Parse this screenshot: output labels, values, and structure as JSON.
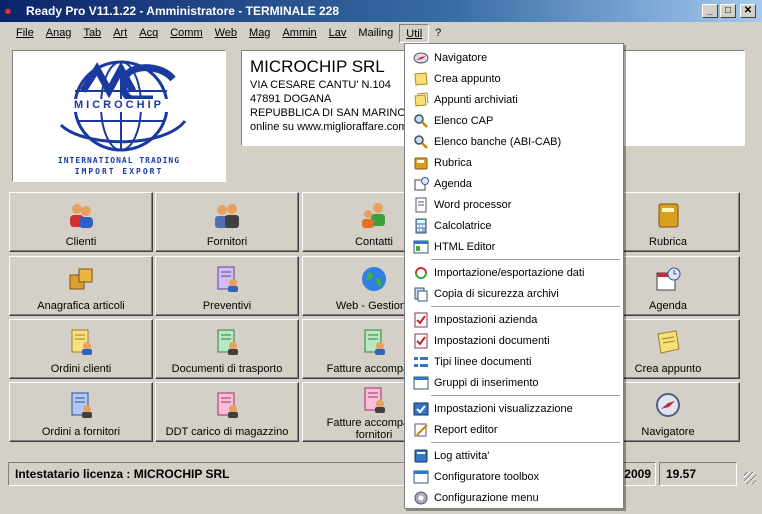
{
  "window": {
    "title": "Ready Pro V11.1.22 - Amministratore - TERMINALE 228",
    "min_glyph": "_",
    "max_glyph": "□",
    "close_glyph": "✕"
  },
  "menubar": {
    "items": [
      "File",
      "Anag",
      "Tab",
      "Art",
      "Acq",
      "Comm",
      "Web",
      "Mag",
      "Ammin",
      "Lav",
      "Mailing",
      "Util",
      "?"
    ],
    "active": "Util"
  },
  "logo": {
    "brand": "MICROCHIP",
    "tagline1": "INTERNATIONAL TRADING",
    "tagline2": "IMPORT  EXPORT"
  },
  "company": {
    "name": "MICROCHIP SRL",
    "address": "VIA CESARE CANTU' N.104",
    "city": "47891 DOGANA",
    "country": "REPUBBLICA DI SAN MARINO",
    "web": "online su www.miglioraffare.com"
  },
  "buttons": [
    {
      "label": "Clienti",
      "icon": "people-icon"
    },
    {
      "label": "Fornitori",
      "icon": "business-people-icon"
    },
    {
      "label": "Contatti",
      "icon": "contacts-icon"
    },
    {
      "label": "Rubrica",
      "icon": "address-book-icon"
    },
    {
      "label": "Anagrafica articoli",
      "icon": "boxes-icon"
    },
    {
      "label": "Preventivi",
      "icon": "quote-document-icon"
    },
    {
      "label": "Web - Gestione",
      "icon": "globe-icon"
    },
    {
      "label": "Agenda",
      "icon": "calendar-clock-icon"
    },
    {
      "label": "Ordini clienti",
      "icon": "customer-orders-icon"
    },
    {
      "label": "Documenti di trasporto",
      "icon": "transport-document-icon"
    },
    {
      "label": "Fatture accompagn",
      "icon": "invoice-icon"
    },
    {
      "label": "Crea appunto",
      "icon": "note-icon"
    },
    {
      "label": "Ordini a fornitori",
      "icon": "supplier-orders-icon"
    },
    {
      "label": "DDT carico di magazzino",
      "icon": "warehouse-document-icon"
    },
    {
      "label": "Fatture accompagn",
      "label2": "fornitori",
      "icon": "supplier-invoice-icon"
    },
    {
      "label": "Navigatore",
      "icon": "navigator-icon"
    }
  ],
  "status": {
    "license": "Intestatario licenza : MICROCHIP SRL",
    "date_fragment": "2009",
    "time": "19.57"
  },
  "util_menu": {
    "items": [
      {
        "label": "Navigatore",
        "icon": "compass-icon"
      },
      {
        "label": "Crea appunto",
        "icon": "note-icon"
      },
      {
        "label": "Appunti archiviati",
        "icon": "notes-archive-icon"
      },
      {
        "label": "Elenco CAP",
        "icon": "magnifier-icon"
      },
      {
        "label": "Elenco banche (ABI-CAB)",
        "icon": "magnifier-icon"
      },
      {
        "label": "Rubrica",
        "icon": "address-book-icon"
      },
      {
        "label": "Agenda",
        "icon": "agenda-icon"
      },
      {
        "label": "Word processor",
        "icon": "document-icon"
      },
      {
        "label": "Calcolatrice",
        "icon": "calculator-icon"
      },
      {
        "label": "HTML Editor",
        "icon": "html-editor-icon"
      },
      {
        "label": "Importazione/esportazione dati",
        "icon": "import-export-icon"
      },
      {
        "label": "Copia di sicurezza archivi",
        "icon": "backup-icon"
      },
      {
        "label": "Impostazioni azienda",
        "icon": "checklist-icon"
      },
      {
        "label": "Impostazioni documenti",
        "icon": "checklist-icon"
      },
      {
        "label": "Tipi linee documenti",
        "icon": "list-lines-icon"
      },
      {
        "label": "Gruppi di inserimento",
        "icon": "window-icon"
      },
      {
        "label": "Impostazioni visualizzazione",
        "icon": "display-settings-icon"
      },
      {
        "label": "Report editor",
        "icon": "report-editor-icon"
      },
      {
        "label": "Log attivita'",
        "icon": "log-book-icon"
      },
      {
        "label": "Configuratore toolbox",
        "icon": "window-icon"
      },
      {
        "label": "Configurazione menu",
        "icon": "menu-config-icon"
      }
    ]
  },
  "colors": {
    "title_start": "#0a246a",
    "title_end": "#a6caf0",
    "face": "#d4d0c8",
    "logo_blue": "#1a3aa0"
  }
}
